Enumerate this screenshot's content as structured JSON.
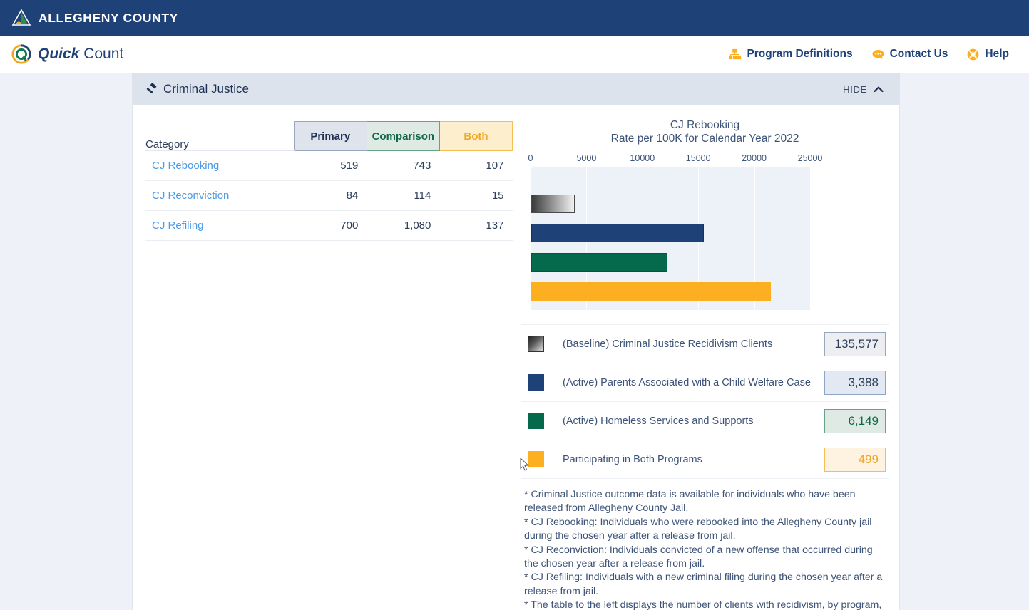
{
  "county_bar": {
    "title": "ALLEGHENY COUNTY",
    "logo_icon": "allegheny-triangle-logo"
  },
  "brand_bar": {
    "logo_icon": "quick-count-circle-logo",
    "word_quick": "Quick",
    "word_count": " Count",
    "nav": [
      {
        "label": "Program Definitions",
        "icon": "org-chart-icon"
      },
      {
        "label": "Contact Us",
        "icon": "chat-bubble-icon"
      },
      {
        "label": "Help",
        "icon": "life-ring-icon"
      }
    ]
  },
  "card": {
    "title": "Criminal Justice",
    "title_icon": "gavel-icon",
    "hide_label": "HIDE",
    "hide_icon": "chevron-up-icon"
  },
  "table": {
    "headers": [
      "Category",
      "Primary",
      "Comparison",
      "Both"
    ],
    "rows": [
      {
        "category": "CJ Rebooking",
        "primary": "519",
        "comparison": "743",
        "both": "107"
      },
      {
        "category": "CJ Reconviction",
        "primary": "84",
        "comparison": "114",
        "both": "15"
      },
      {
        "category": "CJ Refiling",
        "primary": "700",
        "comparison": "1,080",
        "both": "137"
      }
    ]
  },
  "chart_data": {
    "type": "bar",
    "orientation": "horizontal",
    "title": "CJ Rebooking",
    "subtitle": "Rate per 100K for Calendar Year 2022",
    "xlabel": "",
    "ylabel": "",
    "xlim": [
      0,
      25000
    ],
    "ticks": [
      0,
      5000,
      10000,
      15000,
      20000,
      25000
    ],
    "tick_labels": [
      "0",
      "5000",
      "10000",
      "15000",
      "20000",
      "25000"
    ],
    "grid": true,
    "legend_position": "below",
    "categories": [
      "(Baseline) Criminal Justice Recidivism Clients",
      "(Active) Parents Associated with a Child Welfare Case",
      "(Active) Homeless Services and Supports",
      "Participating in Both Programs"
    ],
    "values": [
      3890,
      15430,
      12180,
      21430
    ],
    "colors": [
      "#4a4a4a",
      "#1e4178",
      "#05694b",
      "#fbaf21"
    ]
  },
  "legend": {
    "rows": [
      {
        "label": "(Baseline) Criminal Justice Recidivism Clients",
        "value": "135,577",
        "swatch": "baseline-gradient-swatch"
      },
      {
        "label": "(Active) Parents Associated with a Child Welfare Case",
        "value": "3,388",
        "swatch": "primary-navy-swatch"
      },
      {
        "label": "(Active) Homeless Services and Supports",
        "value": "6,149",
        "swatch": "comparison-green-swatch"
      },
      {
        "label": "Participating in Both Programs",
        "value": "499",
        "swatch": "both-orange-swatch"
      }
    ]
  },
  "footnotes": {
    "line1": "* Criminal Justice outcome data is available for individuals who have been released from Allegheny County Jail.",
    "line2": "* CJ Rebooking: Individuals who were rebooked into the Allegheny County jail during the chosen year after a release from jail.",
    "line3": "* CJ Reconviction: Individuals convicted of a new offense that occurred during the chosen year after a release from jail.",
    "line4": "* CJ Refiling: Individuals with a new criminal filing during the chosen year after a",
    "line5": "release from jail.",
    "line6": "* The table to the left displays the number of clients with recidivism, by program,"
  },
  "colors": {
    "brand_navy": "#1e4178",
    "accent_orange": "#fbaf21",
    "comparison_green": "#05694b",
    "link_blue": "#4a9ae8"
  }
}
